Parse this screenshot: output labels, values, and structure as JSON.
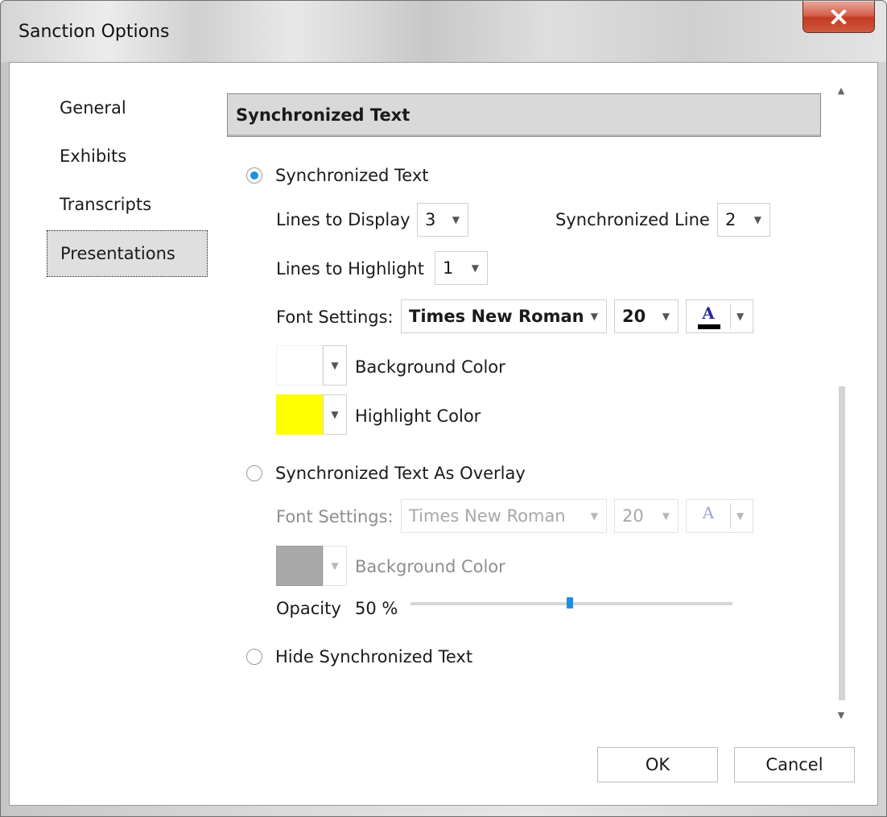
{
  "window": {
    "title": "Sanction Options",
    "close_label": "X"
  },
  "nav": {
    "items": [
      {
        "label": "General"
      },
      {
        "label": "Exhibits"
      },
      {
        "label": "Transcripts"
      },
      {
        "label": "Presentations",
        "selected": true
      }
    ]
  },
  "section": {
    "header": "Synchronized Text"
  },
  "sync_text": {
    "radio_label": "Synchronized Text",
    "selected": true,
    "lines_to_display_label": "Lines to Display",
    "lines_to_display_value": "3",
    "synchronized_line_label": "Synchronized Line",
    "synchronized_line_value": "2",
    "lines_to_highlight_label": "Lines to Highlight",
    "lines_to_highlight_value": "1",
    "font_settings_label": "Font Settings:",
    "font_family_value": "Times New Roman",
    "font_size_value": "20",
    "font_color_glyph": "A",
    "font_color": "#000000",
    "background_color_label": "Background Color",
    "background_color": "#ffffff",
    "highlight_color_label": "Highlight Color",
    "highlight_color": "#ffff00"
  },
  "overlay": {
    "radio_label": "Synchronized Text As Overlay",
    "selected": false,
    "font_settings_label": "Font Settings:",
    "font_family_value": "Times New Roman",
    "font_size_value": "20",
    "font_color_glyph": "A",
    "background_color_label": "Background Color",
    "background_color": "#a9a9a9",
    "opacity_label": "Opacity",
    "opacity_value": "50 %",
    "opacity_fraction": 0.5
  },
  "hide": {
    "radio_label": "Hide Synchronized Text",
    "selected": false
  },
  "buttons": {
    "ok": "OK",
    "cancel": "Cancel"
  },
  "colors": {
    "accent": "#1f8fe0",
    "close_button": "#c8432b"
  }
}
